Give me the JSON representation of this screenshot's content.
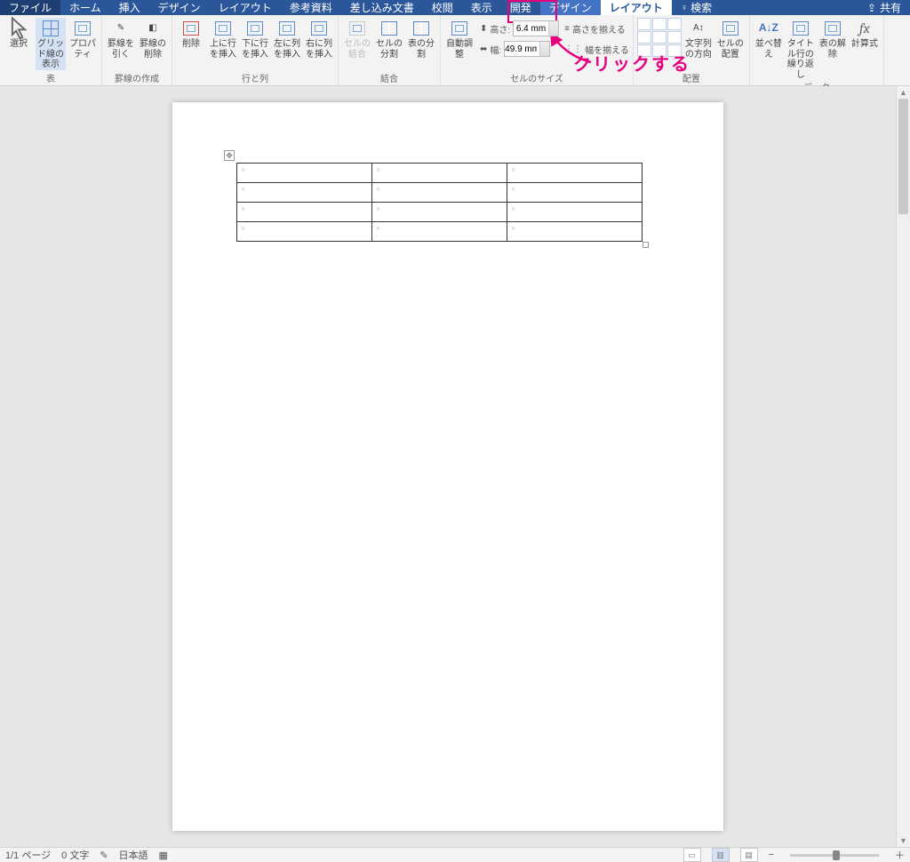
{
  "tabs": {
    "file": "ファイル",
    "home": "ホーム",
    "insert": "挿入",
    "design": "デザイン",
    "layout": "レイアウト",
    "references": "参考資料",
    "mailings": "差し込み文書",
    "review": "校閲",
    "view": "表示",
    "developer": "開発",
    "context_design": "デザイン",
    "context_layout": "レイアウト",
    "tell_me": "検索"
  },
  "share": "共有",
  "annotation": "クリックする",
  "ribbon": {
    "group_table": "表",
    "group_draw": "罫線の作成",
    "group_rowscols": "行と列",
    "group_merge": "結合",
    "group_cellsize": "セルのサイズ",
    "group_align": "配置",
    "group_data": "データ",
    "select": "選択",
    "gridlines": "グリッド線の表示",
    "properties": "プロパティ",
    "draw": "罫線を引く",
    "eraser": "罫線の削除",
    "delete": "削除",
    "insert_above": "上に行を挿入",
    "insert_below": "下に行を挿入",
    "insert_left": "左に列を挿入",
    "insert_right": "右に列を挿入",
    "merge_cells": "セルの結合",
    "split_cells": "セルの分割",
    "split_table": "表の分割",
    "autofit": "自動調整",
    "height_label": "高さ:",
    "height_value": "6.4 mm",
    "width_label": "幅:",
    "width_value": "49.9 mm",
    "distribute_rows": "高さを揃える",
    "distribute_cols": "幅を揃える",
    "text_direction": "文字列の方向",
    "cell_margins": "セルの配置",
    "sort": "並べ替え",
    "repeat_header": "タイトル行の繰り返し",
    "convert": "表の解除",
    "formula": "計算式"
  },
  "statusbar": {
    "page": "1/1 ページ",
    "words": "0 文字",
    "lang": "日本語",
    "zoom_minus": "−",
    "zoom_plus": "＋"
  },
  "table": {
    "rows": 4,
    "cols": 3
  }
}
